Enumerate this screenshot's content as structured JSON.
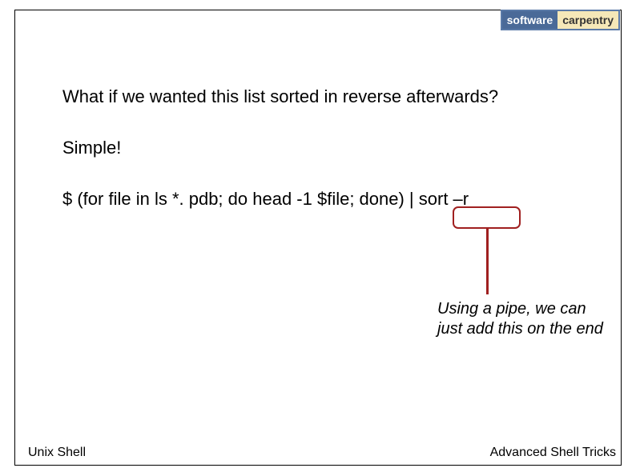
{
  "logo": {
    "left": "software",
    "right": "carpentry"
  },
  "content": {
    "line1": "What if we wanted this list sorted in reverse afterwards?",
    "line2": "Simple!",
    "line3_prefix": "$ ",
    "line3_code": "(for file in ls *. pdb; do head -1 $file; done) | sort –r"
  },
  "callout": {
    "text": "Using a pipe, we can just add this on the end"
  },
  "footer": {
    "left": "Unix Shell",
    "right": "Advanced Shell Tricks"
  }
}
